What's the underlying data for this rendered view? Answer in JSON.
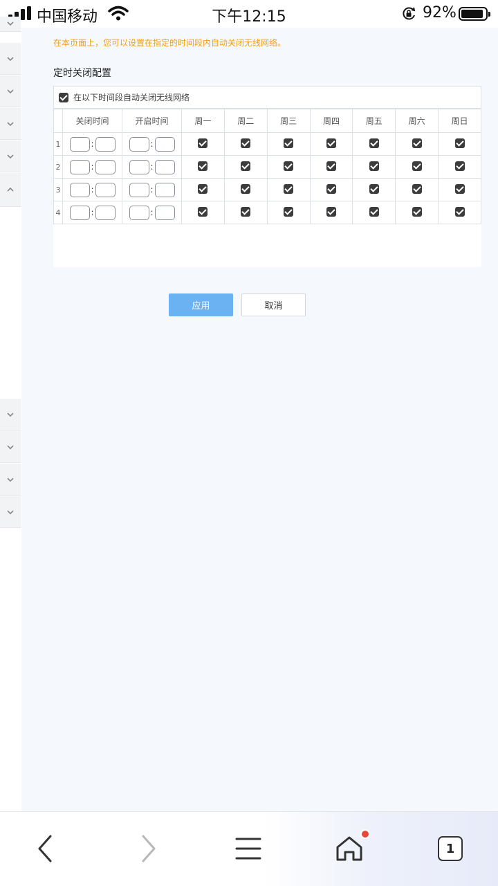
{
  "status_bar": {
    "carrier": "中国移动",
    "time": "下午12:15",
    "battery_percent": "92%",
    "battery_level": 0.92
  },
  "main": {
    "notice": "在本页面上，您可以设置在指定的时间段内自动关闭无线网络。",
    "section_title": "定时关闭配置",
    "enable_checkbox": {
      "label": "在以下时间段自动关闭无线网络",
      "checked": true
    },
    "table": {
      "headers": [
        "关闭时间",
        "开启时间",
        "周一",
        "周二",
        "周三",
        "周四",
        "周五",
        "周六",
        "周日"
      ],
      "rows": [
        {
          "num": "1",
          "close_hour": "",
          "close_min": "",
          "open_hour": "",
          "open_min": "",
          "days": [
            true,
            true,
            true,
            true,
            true,
            true,
            true
          ]
        },
        {
          "num": "2",
          "close_hour": "",
          "close_min": "",
          "open_hour": "",
          "open_min": "",
          "days": [
            true,
            true,
            true,
            true,
            true,
            true,
            true
          ]
        },
        {
          "num": "3",
          "close_hour": "",
          "close_min": "",
          "open_hour": "",
          "open_min": "",
          "days": [
            true,
            true,
            true,
            true,
            true,
            true,
            true
          ]
        },
        {
          "num": "4",
          "close_hour": "",
          "close_min": "",
          "open_hour": "",
          "open_min": "",
          "days": [
            true,
            true,
            true,
            true,
            true,
            true,
            true
          ]
        }
      ],
      "time_separator": ":"
    },
    "apply_label": "应用",
    "cancel_label": "取消"
  },
  "toolbar": {
    "tab_count": "1",
    "icons": [
      "back-icon",
      "forward-icon",
      "menu-icon",
      "home-icon",
      "tabs-icon"
    ]
  },
  "colors": {
    "notice": "#f0a020",
    "apply_button": "#6ab2f2",
    "checkbox": "#3c3c3c",
    "content_bg": "#f5f8fc",
    "notification_dot": "#e8473a"
  }
}
